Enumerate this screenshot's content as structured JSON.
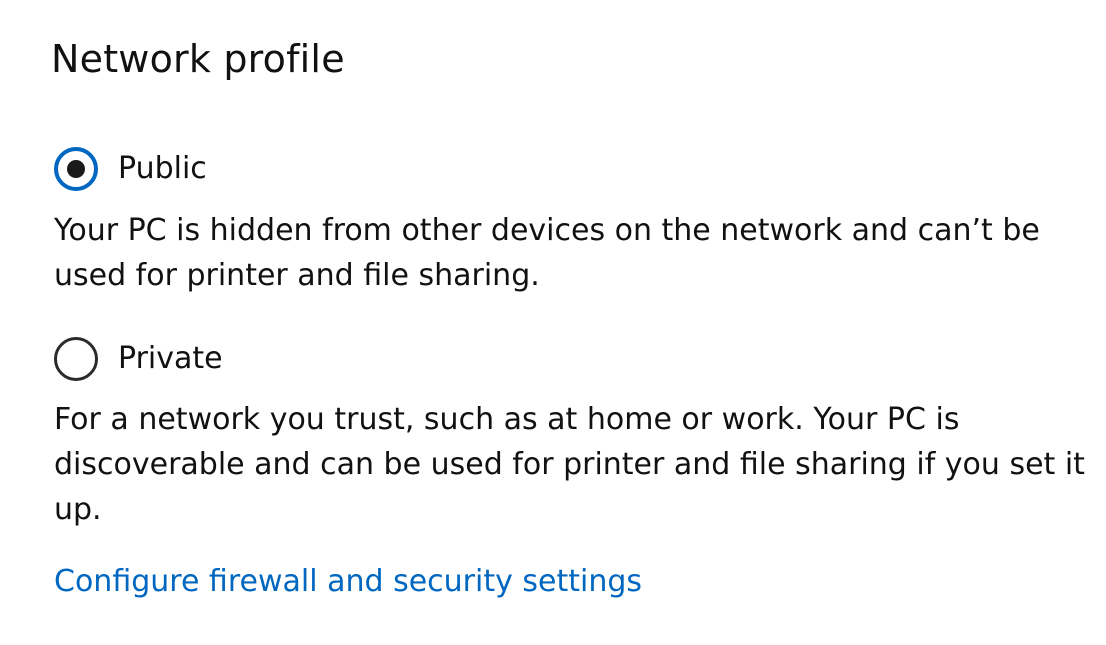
{
  "network_profile": {
    "title": "Network profile",
    "selected": "public",
    "options": [
      {
        "id": "public",
        "label": "Public",
        "checked": true,
        "description": "Your PC is hidden from other devices on the network and can’t be used for printer and file sharing."
      },
      {
        "id": "private",
        "label": "Private",
        "checked": false,
        "description": "For a network you trust, such as at home or work. Your PC is discoverable and can be used for printer and file sharing if you set it up."
      }
    ],
    "link_label": "Configure firewall and security settings"
  },
  "colors": {
    "accent": "#0067c0",
    "text": "#111111",
    "background": "#ffffff"
  }
}
